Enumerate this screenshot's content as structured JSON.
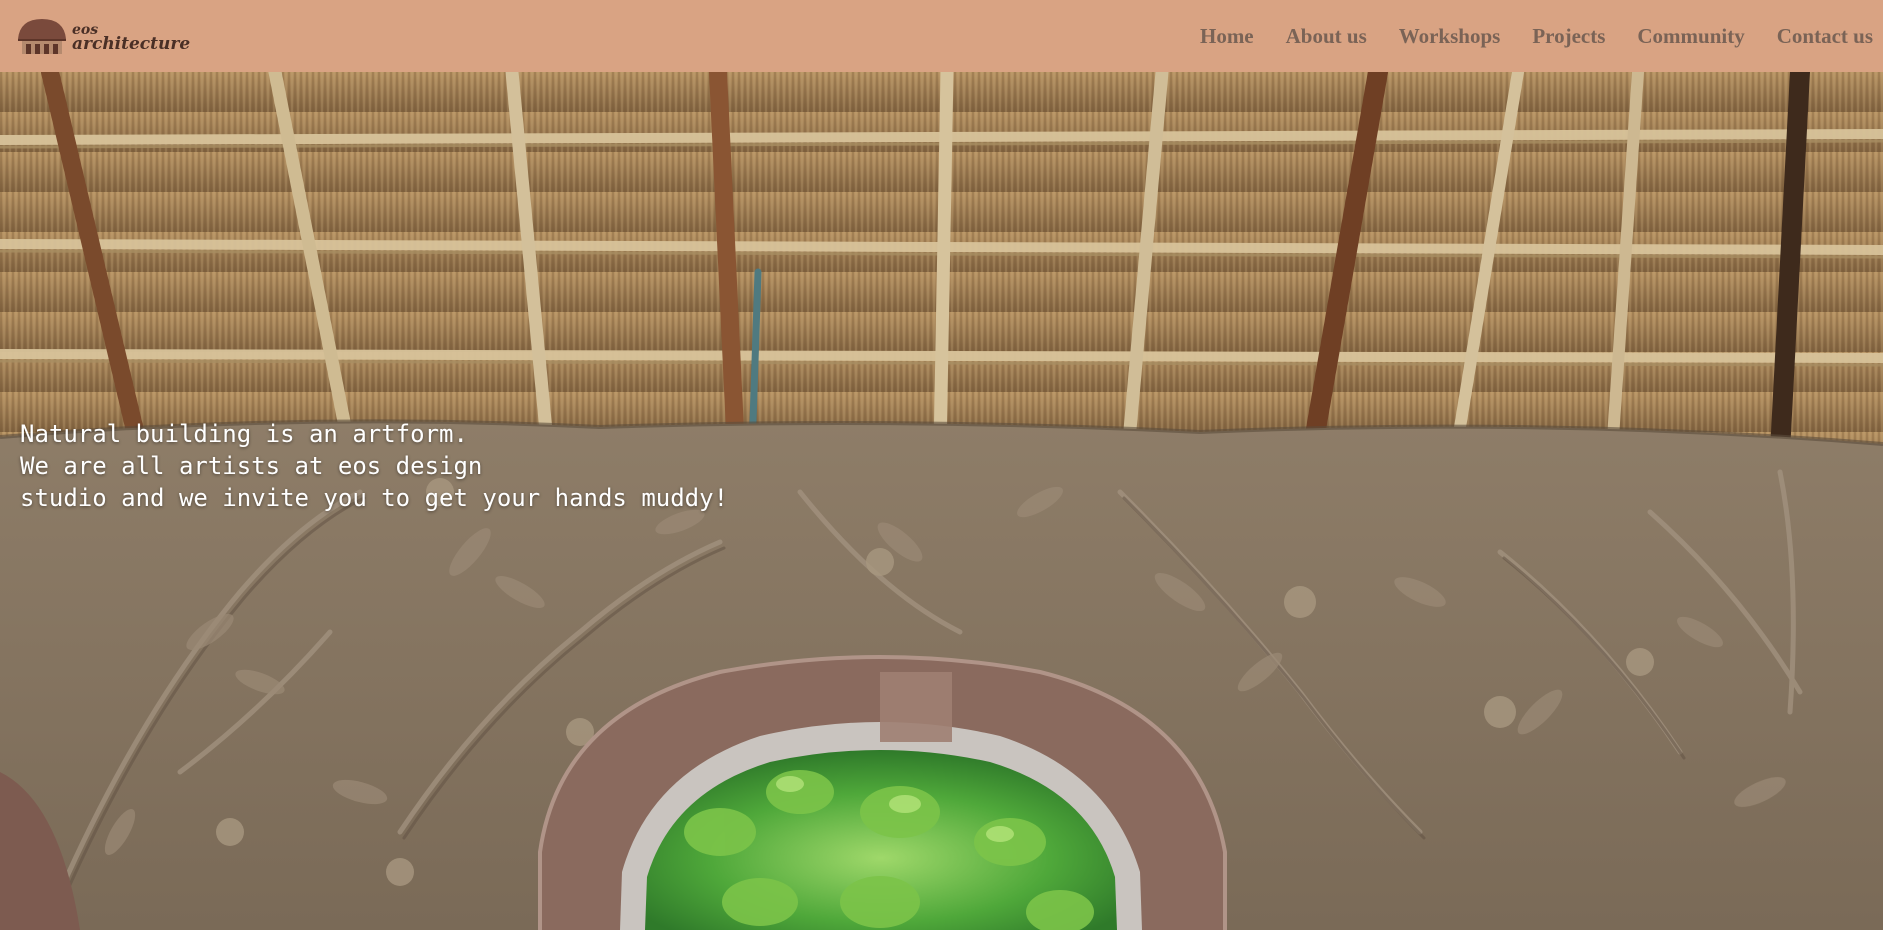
{
  "brand": {
    "line1": "eos",
    "line2": "architecture"
  },
  "nav": {
    "items": [
      {
        "label": "Home"
      },
      {
        "label": "About us"
      },
      {
        "label": "Workshops"
      },
      {
        "label": "Projects"
      },
      {
        "label": "Community"
      },
      {
        "label": "Contact us"
      }
    ]
  },
  "hero": {
    "lines": [
      "Natural building is an artform.",
      "We are all artists at eos design",
      "studio and we invite you to get your hands muddy!"
    ]
  },
  "colors": {
    "header_bg": "#d9a383",
    "nav_text": "#7a6356",
    "logo_text": "#4a2f26"
  }
}
